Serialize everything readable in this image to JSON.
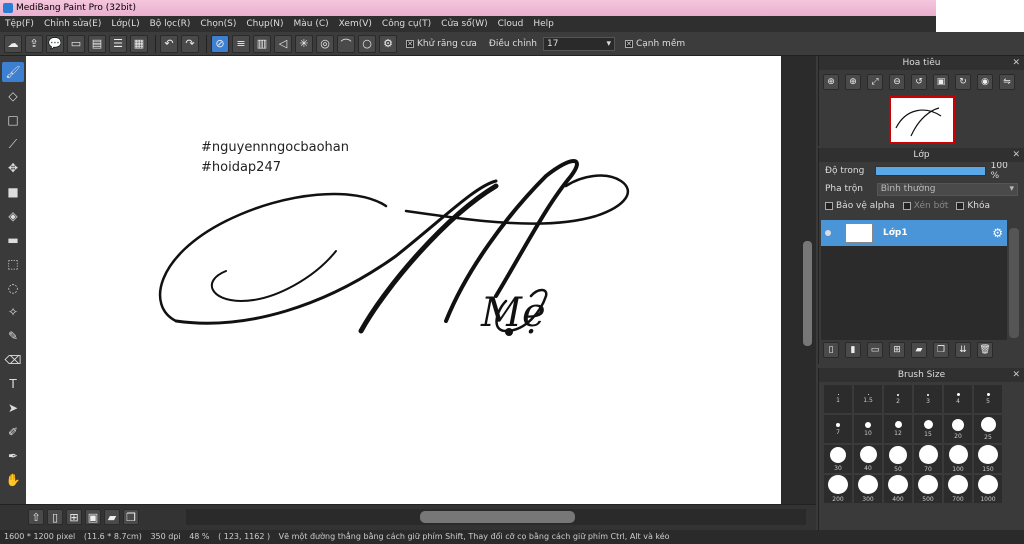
{
  "app": {
    "title": "MediBang Paint Pro (32bit)"
  },
  "menu": [
    "Tệp(F)",
    "Chỉnh sửa(E)",
    "Lớp(L)",
    "Bộ lọc(R)",
    "Chọn(S)",
    "Chụp(N)",
    "Màu (C)",
    "Xem(V)",
    "Công cụ(T)",
    "Cửa sổ(W)",
    "Cloud",
    "Help"
  ],
  "toolbar": {
    "antialias_label": "Khử răng cưa",
    "adjust_label": "Điều chỉnh",
    "adjust_value": "17",
    "edge_label": "Cạnh mềm",
    "antialias_checked": "✕",
    "edge_checked": "✕"
  },
  "canvas": {
    "text_line1": "#nguyennngocbaohan",
    "text_line2": "#hoidap247",
    "script": "Mẹ"
  },
  "navigator": {
    "title": "Hoa tiêu"
  },
  "layers": {
    "title": "Lớp",
    "opacity_label": "Độ trong",
    "opacity_value": "100 %",
    "opacity": 1.0,
    "blend_label": "Pha trộn",
    "blend_value": "Bình thường",
    "protect_alpha": "Bảo vệ alpha",
    "clip": "Xén bớt",
    "lock": "Khóa",
    "layer_name": "Lớp1"
  },
  "brush": {
    "title": "Brush Size",
    "sizes": [
      "1",
      "1.5",
      "2",
      "3",
      "4",
      "5",
      "7",
      "10",
      "12",
      "15",
      "20",
      "25",
      "30",
      "40",
      "50",
      "70",
      "100",
      "150",
      "200",
      "300",
      "400",
      "500",
      "700",
      "1000"
    ]
  },
  "status": {
    "size": "1600 * 1200 pixel",
    "cm": "(11.6 * 8.7cm)",
    "dpi": "350 dpi",
    "zoom": "48 %",
    "coords": "( 123, 1162 )",
    "hint": "Vẽ một đường thẳng bằng cách giữ phím Shift, Thay đổi cỡ cọ bằng cách giữ phím Ctrl, Alt và kéo"
  }
}
